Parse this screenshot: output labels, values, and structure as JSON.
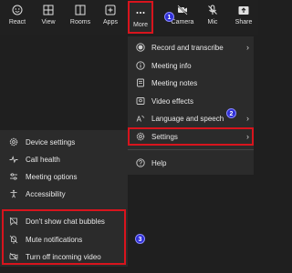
{
  "toolbar": {
    "react": "React",
    "view": "View",
    "rooms": "Rooms",
    "apps": "Apps",
    "more": "More",
    "camera": "Camera",
    "mic": "Mic",
    "share": "Share"
  },
  "badges": {
    "b1": "1",
    "b2": "2",
    "b3": "3"
  },
  "more_menu": {
    "record": "Record and transcribe",
    "meeting_info": "Meeting info",
    "meeting_notes": "Meeting notes",
    "video_effects": "Video effects",
    "language": "Language and speech",
    "settings": "Settings",
    "help": "Help"
  },
  "settings_menu": {
    "device": "Device settings",
    "call_health": "Call health",
    "meeting_options": "Meeting options",
    "accessibility": "Accessibility",
    "chat_bubbles": "Don't show chat bubbles",
    "mute_notifications": "Mute notifications",
    "turn_off_video": "Turn off incoming video"
  },
  "colors": {
    "highlight": "#d8141d",
    "badge": "#2f2fd6",
    "menu_bg": "#2b2b2b",
    "toolbar_bg": "#202020"
  }
}
